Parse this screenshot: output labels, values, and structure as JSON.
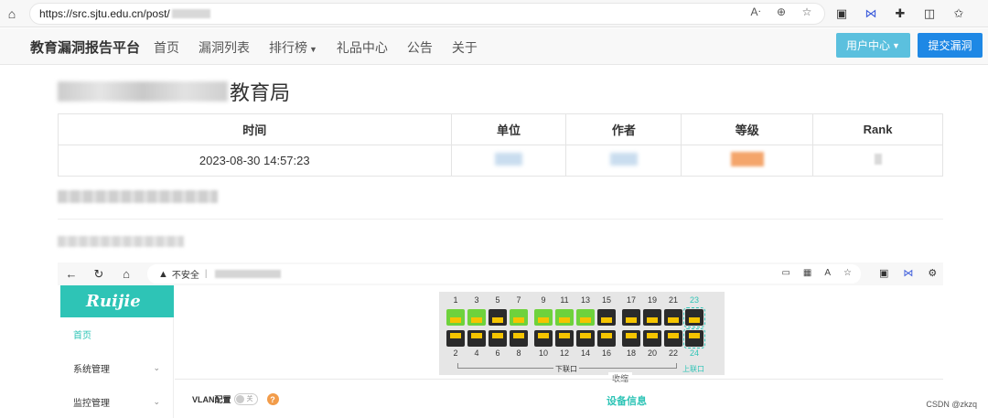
{
  "browser": {
    "url_prefix": "https://src.sjtu.edu.cn/post/",
    "icons": [
      "home-icon",
      "read-aloud-icon",
      "zoom-icon",
      "favorite-icon"
    ]
  },
  "nav": {
    "brand": "教育漏洞报告平台",
    "items": [
      "首页",
      "漏洞列表",
      "排行榜",
      "礼品中心",
      "公告",
      "关于"
    ],
    "user_center": "用户中心",
    "submit": "提交漏洞"
  },
  "post": {
    "title_suffix": "教育局",
    "headers": [
      "时间",
      "单位",
      "作者",
      "等级",
      "Rank"
    ],
    "row": {
      "time": "2023-08-30 14:57:23"
    }
  },
  "inner": {
    "insecure": "不安全",
    "logo": "Ruijie",
    "side": [
      "首页",
      "系统管理",
      "监控管理"
    ],
    "top_ports": [
      "1",
      "3",
      "5",
      "7",
      "9",
      "11",
      "13",
      "15",
      "17",
      "19",
      "21",
      "23"
    ],
    "bottom_ports": [
      "2",
      "4",
      "6",
      "8",
      "10",
      "12",
      "14",
      "16",
      "18",
      "20",
      "22",
      "24"
    ],
    "top_states": [
      "green",
      "green",
      "dark",
      "green",
      "green",
      "green",
      "green",
      "dark",
      "dark",
      "dark",
      "dark",
      "dark"
    ],
    "bottom_states": [
      "dark",
      "dark",
      "dark",
      "dark",
      "dark",
      "dark",
      "dark",
      "dark",
      "dark",
      "dark",
      "dark",
      "dark"
    ],
    "down_label": "下联口",
    "up_label": "上联口",
    "collapse": "收缩",
    "vlan": "VLAN配置",
    "toggle_off": "关",
    "help": "?",
    "device_info": "设备信息"
  },
  "watermark": "CSDN @zkzq"
}
